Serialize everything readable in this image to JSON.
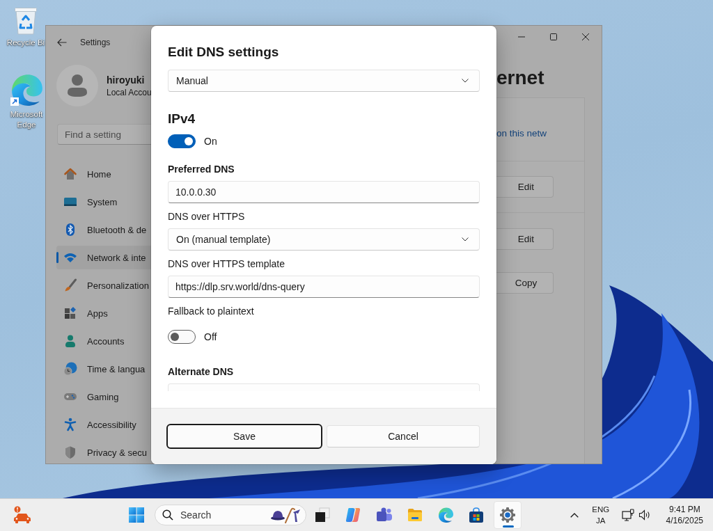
{
  "desktop": {
    "icons": [
      {
        "kind": "recycle-bin",
        "label": "Recycle Bi"
      },
      {
        "kind": "edge",
        "label": "Microsoft Edge"
      }
    ]
  },
  "settings_window": {
    "title": "Settings",
    "user": {
      "name": "hiroyuki",
      "account": "Local Accou"
    },
    "search": {
      "placeholder": "Find a setting"
    },
    "nav": [
      {
        "kind": "home",
        "label": "Home",
        "selected": false
      },
      {
        "kind": "system",
        "label": "System",
        "selected": false
      },
      {
        "kind": "bluetooth",
        "label": "Bluetooth & de",
        "selected": false
      },
      {
        "kind": "network",
        "label": "Network & inte",
        "selected": true
      },
      {
        "kind": "personalization",
        "label": "Personalization",
        "selected": false
      },
      {
        "kind": "apps",
        "label": "Apps",
        "selected": false
      },
      {
        "kind": "accounts",
        "label": "Accounts",
        "selected": false
      },
      {
        "kind": "time",
        "label": "Time & langua",
        "selected": false
      },
      {
        "kind": "gaming",
        "label": "Gaming",
        "selected": false
      },
      {
        "kind": "accessibility",
        "label": "Accessibility",
        "selected": false
      },
      {
        "kind": "privacy",
        "label": "Privacy & secu",
        "selected": false
      }
    ],
    "page_title": "ernet",
    "card": {
      "rows": [
        {
          "link": "on this netw"
        },
        {
          "buttons": [
            "Edit"
          ]
        },
        {
          "buttons": [
            "Edit",
            "Copy"
          ]
        }
      ]
    }
  },
  "dialog": {
    "title": "Edit DNS settings",
    "mode_dropdown": {
      "value": "Manual"
    },
    "items": [
      {
        "kind": "heading",
        "text": "IPv4"
      },
      {
        "kind": "toggle",
        "on": true,
        "label": "On"
      },
      {
        "kind": "group-label",
        "text": "Preferred DNS"
      },
      {
        "kind": "text-field",
        "value": "10.0.0.30"
      },
      {
        "kind": "label",
        "text": "DNS over HTTPS"
      },
      {
        "kind": "dropdown",
        "value": "On (manual template)"
      },
      {
        "kind": "label",
        "text": "DNS over HTTPS template"
      },
      {
        "kind": "text-field",
        "value": "https://dlp.srv.world/dns-query"
      },
      {
        "kind": "label",
        "text": "Fallback to plaintext"
      },
      {
        "kind": "toggle",
        "on": false,
        "label": "Off"
      },
      {
        "kind": "group-label",
        "text": "Alternate DNS"
      },
      {
        "kind": "text-field"
      }
    ],
    "buttons": [
      {
        "label": "Save",
        "focused": true
      },
      {
        "label": "Cancel",
        "focused": false
      }
    ]
  },
  "taskbar": {
    "search": {
      "placeholder": "Search"
    },
    "apps": [
      {
        "kind": "task-view",
        "selected": false
      },
      {
        "kind": "copilot",
        "selected": false
      },
      {
        "kind": "teams",
        "selected": false
      },
      {
        "kind": "file-explorer",
        "selected": false
      },
      {
        "kind": "edge",
        "selected": false
      },
      {
        "kind": "store",
        "selected": false
      },
      {
        "kind": "settings",
        "selected": true
      }
    ],
    "tray": {
      "language": "ENG",
      "keyboard": "JA",
      "time": "9:41 PM",
      "date": "4/16/2025"
    }
  }
}
